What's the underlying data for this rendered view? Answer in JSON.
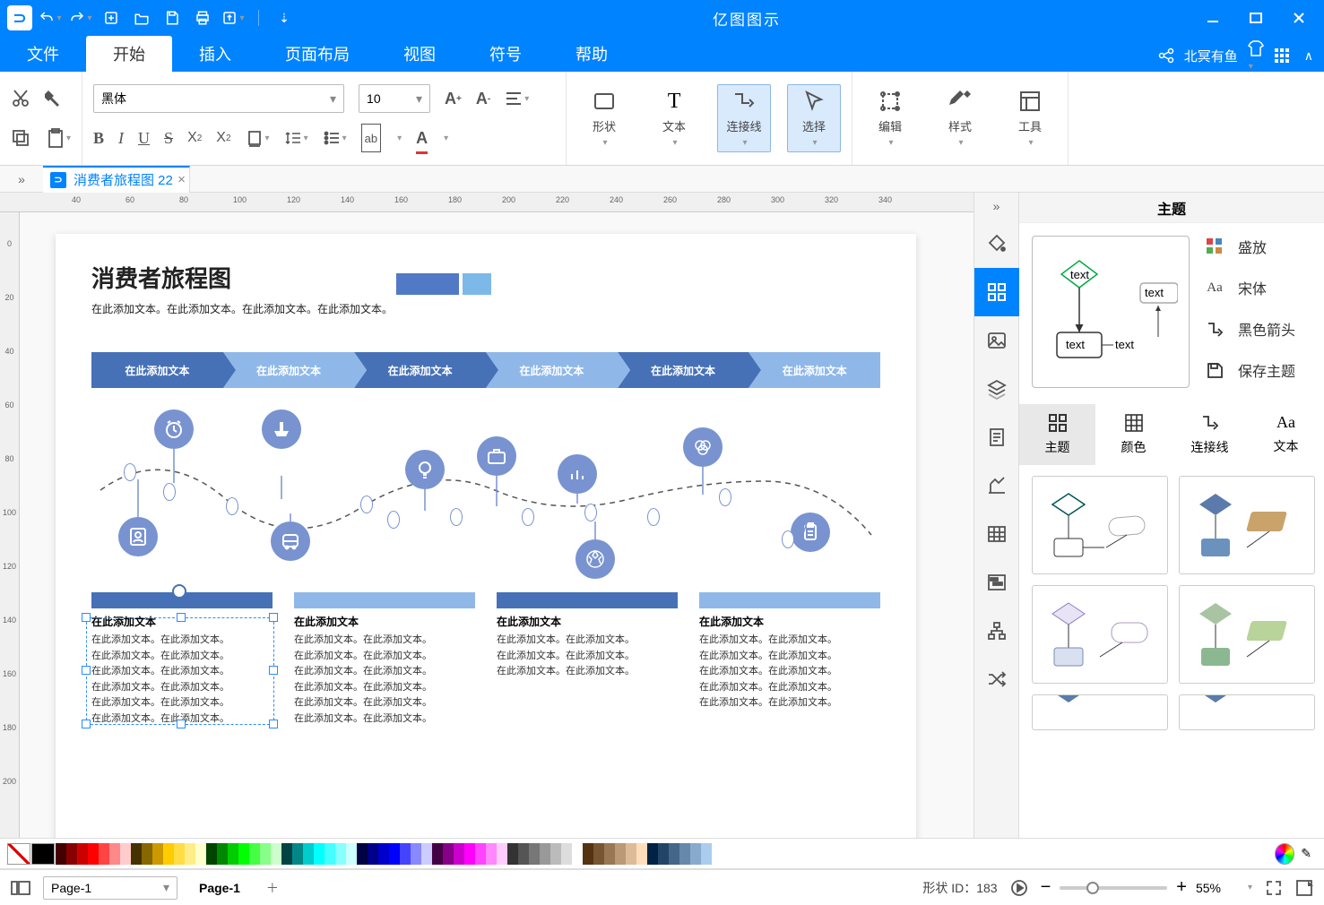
{
  "app": {
    "title": "亿图图示",
    "username": "北冥有鱼"
  },
  "menus": {
    "file": "文件",
    "home": "开始",
    "insert": "插入",
    "pagelayout": "页面布局",
    "view": "视图",
    "symbol": "符号",
    "help": "帮助"
  },
  "ribbon": {
    "font_name": "黑体",
    "font_size": "10",
    "shape": "形状",
    "text": "文本",
    "connector": "连接线",
    "select": "选择",
    "edit": "编辑",
    "style": "样式",
    "tools": "工具"
  },
  "doc_tab": "消费者旅程图 22",
  "canvas": {
    "title": "消费者旅程图",
    "subtitle": "在此添加文本。在此添加文本。在此添加文本。在此添加文本。",
    "chev": [
      "在此添加文本",
      "在此添加文本",
      "在此添加文本",
      "在此添加文本",
      "在此添加文本",
      "在此添加文本"
    ],
    "col_hd": "在此添加文本",
    "col_line": "在此添加文本。在此添加文本。"
  },
  "side": {
    "panel_title": "主题",
    "preview_text": "text",
    "opts": {
      "colorful": "盛放",
      "font": "宋体",
      "arrow": "黑色箭头",
      "save": "保存主题"
    },
    "tabs": {
      "theme": "主题",
      "color": "颜色",
      "conn": "连接线",
      "text": "文本"
    }
  },
  "status": {
    "page_sel": "Page-1",
    "page_tab": "Page-1",
    "shape_id_label": "形状 ID：",
    "shape_id": "183",
    "zoom": "55%"
  },
  "ruler_top": [
    "40",
    "80",
    "120",
    "140",
    "160",
    "180",
    "200",
    "220",
    "240",
    "260",
    "280",
    "300",
    "320",
    "340"
  ],
  "ruler_top_vals": [
    40,
    80,
    120,
    140,
    160,
    180,
    200,
    220,
    240,
    260,
    280,
    300,
    320,
    340
  ]
}
